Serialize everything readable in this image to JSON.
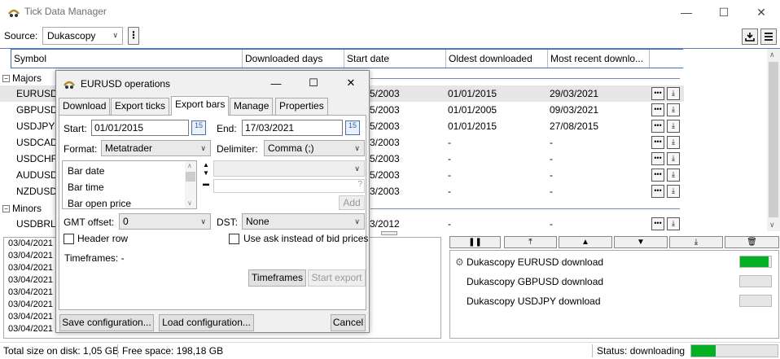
{
  "app": {
    "title": "Tick Data Manager"
  },
  "source": {
    "label": "Source:",
    "value": "Dukascopy",
    "menu": "⋮"
  },
  "grid": {
    "columns": [
      "Symbol",
      "Downloaded days",
      "Start date",
      "Oldest downloaded",
      "Most recent downlo..."
    ],
    "groups": [
      {
        "name": "Majors",
        "toggle": "−"
      },
      {
        "name": "Minors",
        "toggle": "−"
      }
    ],
    "rows": [
      {
        "symbol": "EURUSD",
        "start": "5/2003",
        "oldest": "01/01/2015",
        "recent": "29/03/2021"
      },
      {
        "symbol": "GBPUSD",
        "start": "5/2003",
        "oldest": "01/01/2005",
        "recent": "09/03/2021"
      },
      {
        "symbol": "USDJPY",
        "start": "5/2003",
        "oldest": "01/01/2015",
        "recent": "27/08/2015"
      },
      {
        "symbol": "USDCAD",
        "start": "3/2003",
        "oldest": "-",
        "recent": "-"
      },
      {
        "symbol": "USDCHF",
        "start": "5/2003",
        "oldest": "-",
        "recent": "-"
      },
      {
        "symbol": "AUDUSD",
        "start": "5/2003",
        "oldest": "-",
        "recent": "-"
      },
      {
        "symbol": "NZDUSD",
        "start": "3/2003",
        "oldest": "-",
        "recent": "-"
      },
      {
        "symbol": "USDBRL",
        "start": "3/2012",
        "oldest": "-",
        "recent": "-"
      }
    ]
  },
  "log": {
    "lines": [
      "03/04/2021",
      "03/04/2021",
      "03/04/2021",
      "03/04/2021",
      "03/04/2021",
      "03/04/2021",
      "03/04/2021",
      "03/04/2021"
    ]
  },
  "queue": {
    "items": [
      {
        "label": "Dukascopy EURUSD download",
        "progress": 0.92,
        "active": true
      },
      {
        "label": "Dukascopy GBPUSD download",
        "progress": 0,
        "active": false
      },
      {
        "label": "Dukascopy USDJPY download",
        "progress": 0,
        "active": false
      }
    ]
  },
  "status": {
    "size": "Total size on disk: 1,05 GB",
    "free": "Free space: 198,18 GB",
    "state": "Status: downloading",
    "progress": 0.28
  },
  "dialog": {
    "title": "EURUSD operations",
    "tabs": [
      "Download",
      "Export ticks",
      "Export bars",
      "Manage",
      "Properties"
    ],
    "active_tab": "Export bars",
    "start_label": "Start:",
    "start_value": "01/01/2015",
    "end_label": "End:",
    "end_value": "17/03/2021",
    "calendar_day": "15",
    "format_label": "Format:",
    "format_value": "Metatrader",
    "delimiter_label": "Delimiter:",
    "delimiter_value": "Comma (;)",
    "fields": [
      "Bar date",
      "Bar time",
      "Bar open price"
    ],
    "field_help": "?",
    "add_label": "Add",
    "gmt_label": "GMT offset:",
    "gmt_value": "0",
    "dst_label": "DST:",
    "dst_value": "None",
    "header_row_label": "Header row",
    "ask_label": "Use ask instead of bid prices",
    "timeframes_text": "Timeframes: -",
    "timeframes_btn": "Timeframes",
    "start_export_btn": "Start export",
    "save_btn": "Save configuration...",
    "load_btn": "Load configuration...",
    "cancel_btn": "Cancel"
  },
  "colors": {
    "accent": "#3a6fcf",
    "progress": "#06b025",
    "selected_row": "#e6e6e6"
  }
}
